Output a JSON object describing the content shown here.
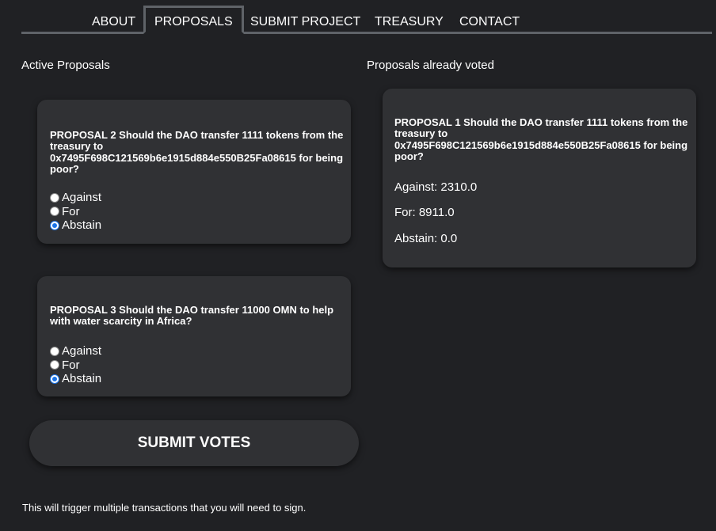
{
  "nav": {
    "tabs": [
      {
        "label": "ABOUT"
      },
      {
        "label": "PROPOSALS"
      },
      {
        "label": "SUBMIT PROJECT"
      },
      {
        "label": "TREASURY"
      },
      {
        "label": "CONTACT"
      }
    ],
    "active": "PROPOSALS"
  },
  "active_section": {
    "title": "Active Proposals",
    "proposals": [
      {
        "text": "PROPOSAL 2 Should the DAO transfer 1111 tokens from the treasury to 0x7495F698C121569b6e1915d884e550B25Fa08615 for being poor?",
        "options": [
          "Against",
          "For",
          "Abstain"
        ],
        "selected": "Abstain"
      },
      {
        "text": "PROPOSAL 3 Should the DAO transfer 11000 OMN to help with water scarcity in Africa?",
        "options": [
          "Against",
          "For",
          "Abstain"
        ],
        "selected": "Abstain"
      }
    ],
    "submit_label": "SUBMIT VOTES",
    "note": "This will trigger multiple transactions that you will need to sign."
  },
  "voted_section": {
    "title": "Proposals already voted",
    "proposals": [
      {
        "text": "PROPOSAL 1 Should the DAO transfer 1111 tokens from the treasury to 0x7495F698C121569b6e1915d884e550B25Fa08615 for being poor?",
        "results": [
          "Against: 2310.0",
          "For: 8911.0",
          "Abstain: 0.0"
        ]
      }
    ]
  },
  "colors": {
    "background": "#202124",
    "card": "#303134",
    "border": "#5f6368",
    "radio_selected": "#1a73e8"
  }
}
